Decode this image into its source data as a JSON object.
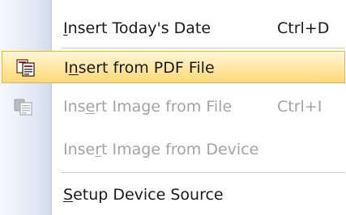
{
  "menu": {
    "items": [
      {
        "before": "",
        "mnemonic": "I",
        "after": "nsert Today's Date",
        "shortcut": "Ctrl+D",
        "state": "enabled"
      },
      {
        "before": "I",
        "mnemonic": "n",
        "after": "sert from PDF File",
        "shortcut": "",
        "state": "selected",
        "icon": "pdf-insert-icon"
      },
      {
        "before": "Ins",
        "mnemonic": "e",
        "after": "rt Image from File",
        "shortcut": "Ctrl+I",
        "state": "disabled",
        "icon": "image-insert-icon"
      },
      {
        "before": "Inse",
        "mnemonic": "r",
        "after": "t Image from Device",
        "shortcut": "",
        "state": "disabled"
      },
      {
        "before": "",
        "mnemonic": "S",
        "after": "etup Device Source",
        "shortcut": "",
        "state": "enabled"
      }
    ]
  },
  "colors": {
    "highlight_border": "#e8b63a",
    "highlight_fill": "#ffe7a6",
    "disabled_text": "#a3a3a3"
  }
}
